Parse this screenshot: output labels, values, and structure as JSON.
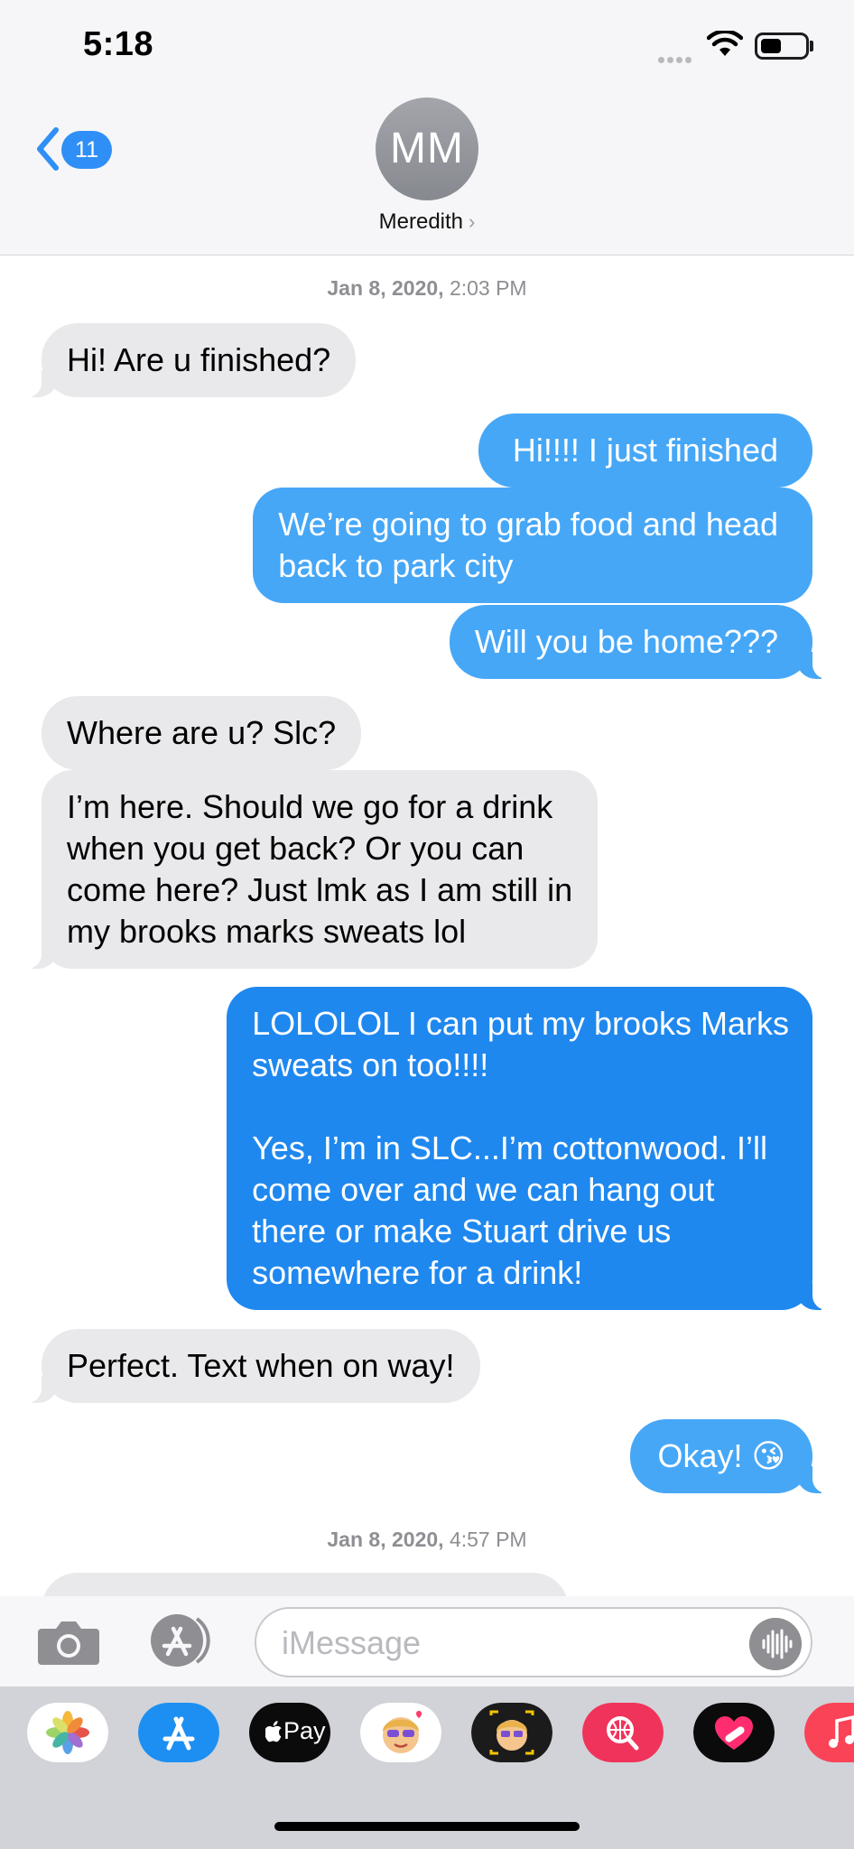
{
  "status_bar": {
    "time": "5:18"
  },
  "header": {
    "back_badge": "11",
    "avatar_initials": "MM",
    "contact_name": "Meredith",
    "contact_arrow": "›"
  },
  "timestamps": [
    {
      "date": "Jan 8, 2020,",
      "time": "2:03 PM"
    },
    {
      "date": "Jan 8, 2020,",
      "time": "4:57 PM"
    }
  ],
  "messages": [
    {
      "direction": "in",
      "text": "Hi! Are u finished?"
    },
    {
      "direction": "out",
      "text": "Hi!!!! I just finished"
    },
    {
      "direction": "out",
      "text": "We’re going to grab food and head\nback to park city"
    },
    {
      "direction": "out",
      "text": "Will you be home???"
    },
    {
      "direction": "in",
      "text": "Where are u? Slc?"
    },
    {
      "direction": "in",
      "text": "I’m here.  Should we go for a drink\nwhen you get back? Or you can\ncome here? Just lmk as I am still in\nmy brooks marks sweats lol"
    },
    {
      "direction": "out",
      "text": "LOLOLOL I can put my brooks Marks\nsweats on too!!!!\n\nYes, I’m in SLC...I’m cottonwood. I’ll\ncome over and we can hang out\nthere or make Stuart drive us\nsomewhere for a drink!"
    },
    {
      "direction": "in",
      "text": "Perfect.  Text when on way!"
    },
    {
      "direction": "out",
      "text": "Okay! 😘"
    }
  ],
  "input": {
    "placeholder": "iMessage"
  },
  "app_drawer": {
    "apps": [
      "photos-app",
      "app-store-app",
      "apple-pay-app",
      "memoji-stickers-app",
      "animoji-app",
      "image-search-app",
      "digital-touch-app",
      "music-app"
    ],
    "apple_pay_label": "Pay"
  },
  "colors": {
    "outgoing_bubble": "#46a7f7",
    "outgoing_bubble_long": "#1f88ef",
    "incoming_bubble": "#e9e9eb",
    "badge": "#2f8ff6"
  }
}
